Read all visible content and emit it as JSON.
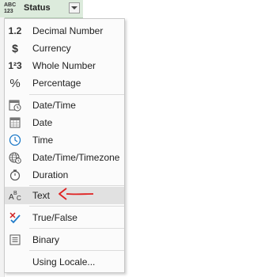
{
  "column_header": {
    "type_icon_line1": "ABC",
    "type_icon_line2": "123",
    "title": "Status"
  },
  "menu": {
    "items": [
      {
        "label": "Decimal Number",
        "icon": "decimal-number-icon",
        "glyph": "1.2"
      },
      {
        "label": "Currency",
        "icon": "currency-icon",
        "glyph": "$"
      },
      {
        "label": "Whole Number",
        "icon": "whole-number-icon",
        "glyph": "1²3"
      },
      {
        "label": "Percentage",
        "icon": "percentage-icon",
        "glyph": "%"
      },
      {
        "label": "Date/Time",
        "icon": "date-time-icon"
      },
      {
        "label": "Date",
        "icon": "date-icon"
      },
      {
        "label": "Time",
        "icon": "time-icon"
      },
      {
        "label": "Date/Time/Timezone",
        "icon": "globe-icon"
      },
      {
        "label": "Duration",
        "icon": "duration-icon"
      },
      {
        "label": "Text",
        "icon": "text-type-icon",
        "glyph": "ABC"
      },
      {
        "label": "True/False",
        "icon": "true-false-icon"
      },
      {
        "label": "Binary",
        "icon": "binary-icon"
      },
      {
        "label": "Using Locale...",
        "icon": ""
      }
    ]
  },
  "colors": {
    "header_bg": "#dcebdc",
    "hover_bg": "#e1e1e1",
    "arrow": "#e02020",
    "clock_blue": "#1e7ac8"
  }
}
